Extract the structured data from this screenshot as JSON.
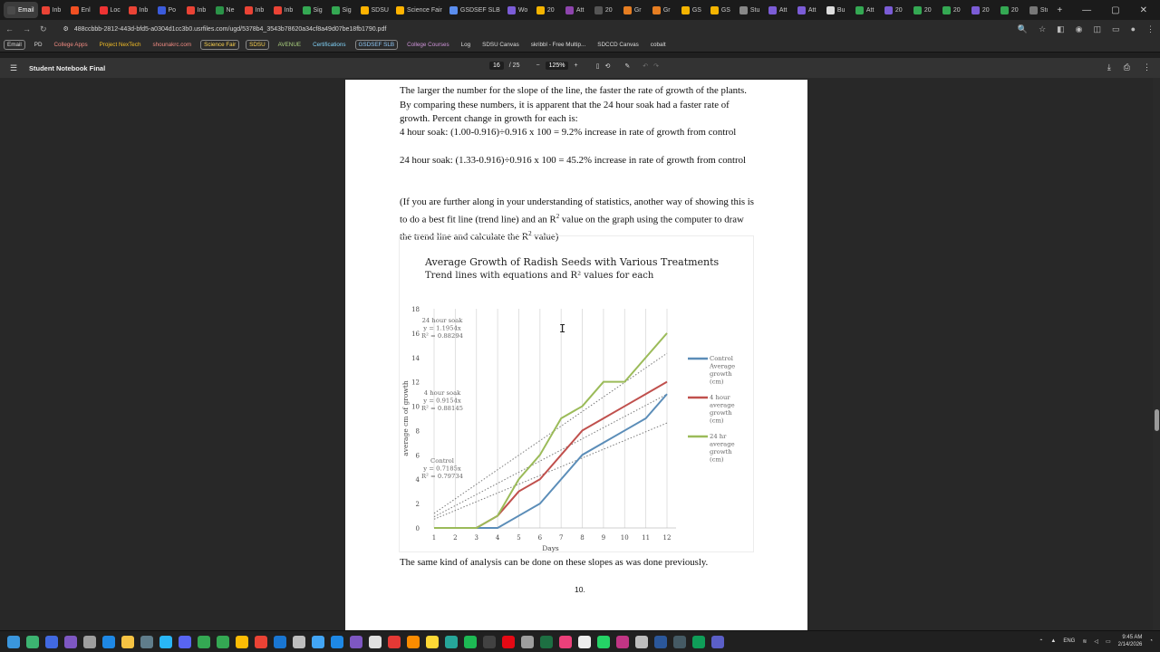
{
  "browser": {
    "tabs": [
      {
        "label": "Email",
        "color": "#4a4a4a",
        "active": true
      },
      {
        "label": "Inb",
        "color": "#ea4335"
      },
      {
        "label": "Enl",
        "color": "#f25022"
      },
      {
        "label": "Loc",
        "color": "#e33"
      },
      {
        "label": "Inb",
        "color": "#ea4335"
      },
      {
        "label": "Po",
        "color": "#3b5bdb"
      },
      {
        "label": "Inb",
        "color": "#ea4335"
      },
      {
        "label": "Ne",
        "color": "#2b9348"
      },
      {
        "label": "Inb",
        "color": "#ea4335"
      },
      {
        "label": "Inb",
        "color": "#ea4335"
      },
      {
        "label": "Sig",
        "color": "#34a853"
      },
      {
        "label": "Sig",
        "color": "#34a853"
      },
      {
        "label": "SDSU",
        "color": "#ffb300"
      },
      {
        "label": "Science Fair",
        "color": "#ffb300"
      },
      {
        "label": "GSDSEF SLB",
        "color": "#5a8dee"
      },
      {
        "label": "Wo",
        "color": "#7b5cd6"
      },
      {
        "label": "20",
        "color": "#f4b400"
      },
      {
        "label": "Att",
        "color": "#8e44ad"
      },
      {
        "label": "20",
        "color": "#555"
      },
      {
        "label": "Gr",
        "color": "#e67e22"
      },
      {
        "label": "Gr",
        "color": "#e67e22"
      },
      {
        "label": "GS",
        "color": "#f4b400"
      },
      {
        "label": "GS",
        "color": "#f4b400"
      },
      {
        "label": "Stu",
        "color": "#888"
      },
      {
        "label": "Att",
        "color": "#7b5cd6"
      },
      {
        "label": "Att",
        "color": "#7b5cd6"
      },
      {
        "label": "Bu",
        "color": "#ddd"
      },
      {
        "label": "Att",
        "color": "#34a853"
      },
      {
        "label": "20",
        "color": "#7b5cd6"
      },
      {
        "label": "20",
        "color": "#34a853"
      },
      {
        "label": "20",
        "color": "#34a853"
      },
      {
        "label": "20",
        "color": "#7b5cd6"
      },
      {
        "label": "20",
        "color": "#34a853"
      },
      {
        "label": "Stu",
        "color": "#777"
      },
      {
        "label": "",
        "color": "#777"
      }
    ],
    "new_tab": "+",
    "url": "488ccbbb-2812-443d-bfd5-a0304d1cc3b0.usrfiles.com/ugd/5378b4_3543b78620a34cf8a49d07be18fb1790.pdf",
    "bookmarks": [
      {
        "label": "Email",
        "boxed": true
      },
      {
        "label": "PD",
        "boxed": false
      },
      {
        "label": "College Apps",
        "boxed": false,
        "color": "#f28b82"
      },
      {
        "label": "Project NexTech",
        "boxed": false,
        "color": "#f6bf26"
      },
      {
        "label": "shounakrc.com",
        "boxed": false,
        "color": "#f28b82"
      },
      {
        "label": "Science Fair",
        "boxed": true,
        "color": "#ffd54f"
      },
      {
        "label": "SDSU",
        "boxed": true,
        "color": "#ffd54f"
      },
      {
        "label": "AVENUE",
        "boxed": false,
        "color": "#aed581"
      },
      {
        "label": "Certifications",
        "boxed": false,
        "color": "#81d4fa"
      },
      {
        "label": "GSDSEF SLB",
        "boxed": true,
        "color": "#90caf9"
      },
      {
        "label": "College Courses",
        "boxed": false,
        "color": "#ce93d8"
      },
      {
        "label": "Log",
        "boxed": false
      },
      {
        "label": "SDSU Canvas",
        "boxed": false
      },
      {
        "label": "skribbl - Free Multip...",
        "boxed": false
      },
      {
        "label": "SDCCD Canvas",
        "boxed": false
      },
      {
        "label": "cobalt",
        "boxed": false
      }
    ]
  },
  "pdf_viewer": {
    "title": "Student Notebook Final",
    "current_page": "16",
    "total_pages": "/ 25",
    "zoom": "125%"
  },
  "page": {
    "para1": "The larger the number for the slope of the line, the faster the rate of growth of the plants.  By comparing these numbers, it is apparent that the 24 hour soak had a faster rate of growth.  Percent change in growth for each is:",
    "para2": "4 hour soak:  (1.00-0.916)÷0.916 x 100 = 9.2% increase in rate of growth from control",
    "para3": "24 hour soak: (1.33-0.916)÷0.916 x 100 =  45.2% increase in rate of growth from control",
    "para4_a": "(If you are further along in your understanding of statistics, another way of showing this is to do a best fit line (trend line) and an R",
    "para4_b": "2",
    "para4_c": " value on the graph using the computer to draw the trend line and calculate the R",
    "para4_d": "2",
    "para4_e": " value)",
    "para5": "The same kind of analysis can be done on these slopes as was done previously.",
    "page_number": "10."
  },
  "chart_data": {
    "type": "line",
    "title": "Average Growth of Radish Seeds with Various Treatments",
    "subtitle": "Trend lines with equations and R² values for each",
    "xlabel": "Days",
    "ylabel": "average cm of growth",
    "x": [
      1,
      2,
      3,
      4,
      5,
      6,
      7,
      8,
      9,
      10,
      11,
      12
    ],
    "xlim": [
      1,
      12
    ],
    "ylim": [
      0,
      18
    ],
    "yticks": [
      0,
      2,
      4,
      6,
      8,
      10,
      12,
      14,
      16,
      18
    ],
    "series": [
      {
        "name": "Control Average growth (cm)",
        "legend_lines": [
          "Control",
          "Average",
          "growth",
          "(cm)"
        ],
        "color": "#5b8db8",
        "values": [
          0,
          0,
          0,
          0,
          1,
          2,
          4,
          6,
          7,
          8,
          9,
          11
        ],
        "slope": 0.7185
      },
      {
        "name": "4 hour average growth (cm)",
        "legend_lines": [
          "4 hour",
          "average",
          "growth",
          "(cm)"
        ],
        "color": "#c0504d",
        "values": [
          0,
          0,
          0,
          1,
          3,
          4,
          6,
          8,
          9,
          10,
          11,
          12
        ],
        "slope": 0.9154
      },
      {
        "name": "24 hr average growth (cm)",
        "legend_lines": [
          "24 hr",
          "average",
          "growth",
          "(cm)"
        ],
        "color": "#9bbb59",
        "values": [
          0,
          0,
          0,
          1,
          4,
          6,
          9,
          10,
          12,
          12,
          14,
          16
        ],
        "slope": 1.1954
      }
    ],
    "annotations": [
      {
        "lines": [
          "24 hour soak",
          "y = 1.1954x",
          "R² = 0.88294"
        ]
      },
      {
        "lines": [
          "4 hour soak",
          "y = 0.9154x",
          "R² = 0.88145"
        ]
      },
      {
        "lines": [
          "Control",
          "y = 0.7185x",
          "R² = 0.79734"
        ]
      }
    ],
    "grid": "vertical",
    "legend_position": "right"
  },
  "taskbar": {
    "icons": [
      {
        "name": "windows-start-icon",
        "color": "#3a96dd"
      },
      {
        "name": "app-green-icon",
        "color": "#3cb371"
      },
      {
        "name": "app-shield-icon",
        "color": "#4169e1"
      },
      {
        "name": "app-vpn-icon",
        "color": "#7e57c2"
      },
      {
        "name": "settings-icon",
        "color": "#9e9e9e"
      },
      {
        "name": "app-blue-icon",
        "color": "#1e88e5"
      },
      {
        "name": "file-explorer-icon",
        "color": "#f6c343"
      },
      {
        "name": "app-calculator-icon",
        "color": "#607d8b"
      },
      {
        "name": "app-photos-icon",
        "color": "#29b6f6"
      },
      {
        "name": "app-discord-icon",
        "color": "#5865f2"
      },
      {
        "name": "chrome-icon",
        "color": "#34a853"
      },
      {
        "name": "chrome-icon-2",
        "color": "#34a853"
      },
      {
        "name": "chrome-icon-3",
        "color": "#fbbc05"
      },
      {
        "name": "chrome-icon-4",
        "color": "#ea4335"
      },
      {
        "name": "mail-icon",
        "color": "#1976d2"
      },
      {
        "name": "app-gear-icon",
        "color": "#bdbdbd"
      },
      {
        "name": "app-copilot-icon",
        "color": "#42a5f5"
      },
      {
        "name": "vscode-icon",
        "color": "#1e88e5"
      },
      {
        "name": "app-purple-icon",
        "color": "#7e57c2"
      },
      {
        "name": "github-icon",
        "color": "#e0e0e0"
      },
      {
        "name": "app-red-icon",
        "color": "#e53935"
      },
      {
        "name": "app-orange-icon",
        "color": "#fb8c00"
      },
      {
        "name": "app-yellow-icon",
        "color": "#fdd835"
      },
      {
        "name": "app-drive-icon",
        "color": "#26a69a"
      },
      {
        "name": "spotify-icon",
        "color": "#1db954"
      },
      {
        "name": "app-black-icon",
        "color": "#424242"
      },
      {
        "name": "netflix-icon",
        "color": "#e50914"
      },
      {
        "name": "app-github-desktop-icon",
        "color": "#9e9e9e"
      },
      {
        "name": "excel-icon",
        "color": "#1d6f42"
      },
      {
        "name": "app-pink-icon",
        "color": "#ec407a"
      },
      {
        "name": "app-white-icon",
        "color": "#eeeeee"
      },
      {
        "name": "whatsapp-icon",
        "color": "#25d366"
      },
      {
        "name": "instagram-icon",
        "color": "#c13584"
      },
      {
        "name": "app-chart-icon",
        "color": "#bdbdbd"
      },
      {
        "name": "word-icon",
        "color": "#2b579a"
      },
      {
        "name": "terminal-icon",
        "color": "#455a64"
      },
      {
        "name": "app-green-sheet-icon",
        "color": "#0f9d58"
      },
      {
        "name": "app-teams-icon",
        "color": "#5b5fc7"
      }
    ],
    "lang": "ENG",
    "time": "9:45 AM",
    "date": "2/14/2026"
  }
}
